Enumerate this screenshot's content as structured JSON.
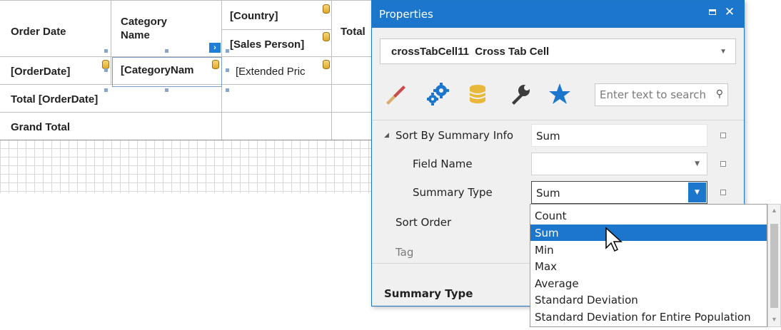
{
  "crosstab": {
    "header_order_date": "Order Date",
    "header_category_name": "Category Name",
    "header_country": "[Country]",
    "header_sales_person": "[Sales Person]",
    "header_total": "Total",
    "cell_order_date": "[OrderDate]",
    "cell_category_name": "[CategoryNam",
    "cell_extended_price": "[Extended Pric",
    "row_total_order_date": "Total [OrderDate]",
    "row_grand_total": "Grand Total"
  },
  "panel": {
    "title": "Properties",
    "selected_object": "crossTabCell11",
    "selected_object_type": "Cross Tab Cell",
    "search_placeholder": "Enter text to search",
    "tab_icons": [
      "appearance-brush-icon",
      "behavior-gears-icon",
      "data-database-icon",
      "design-wrench-icon",
      "favorites-star-icon"
    ],
    "properties": {
      "sort_by_summary_info_label": "Sort By Summary Info",
      "sort_by_summary_info_value": "Sum",
      "field_name_label": "Field Name",
      "field_name_value": "",
      "summary_type_label": "Summary Type",
      "summary_type_value": "Sum",
      "sort_order_label": "Sort Order",
      "tag_label": "Tag"
    },
    "description_title": "Summary Type"
  },
  "summary_type_dropdown": {
    "options": [
      "Count",
      "Sum",
      "Min",
      "Max",
      "Average",
      "Standard Deviation",
      "Standard Deviation for Entire Population"
    ],
    "selected": "Sum"
  },
  "colors": {
    "accent": "#1b76cc",
    "title_bar": "#1b76cc",
    "panel_bg": "#f0f0f0",
    "database_icon": "#e8b83a"
  }
}
